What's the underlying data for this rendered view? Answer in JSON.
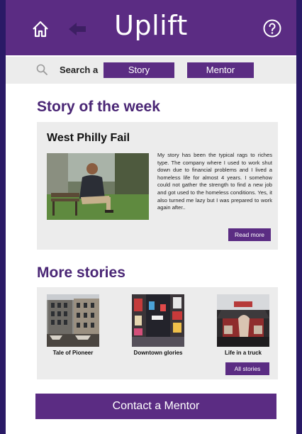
{
  "header": {
    "title": "Uplift",
    "icons": {
      "home": "home-icon",
      "back": "back-arrow-icon",
      "help": "help-icon"
    }
  },
  "search": {
    "label": "Search a",
    "options": [
      "Story",
      "Mentor"
    ]
  },
  "story_of_week": {
    "section_title": "Story of the week",
    "story_title": "West Philly Fail",
    "excerpt": "My story has been the typical rags to riches type. The company where I used to work shut down due to financial problems and I lived a homeless life for almost 4 years. I somehow could not gather the strength to find a new job and got used to the homeless conditions. Yes, it also turned me lazy but I was prepared to work again after..",
    "read_more_label": "Read more"
  },
  "more_stories": {
    "section_title": "More stories",
    "items": [
      {
        "label": "Tale of Pioneer"
      },
      {
        "label": "Downtown glories"
      },
      {
        "label": "Life in a truck"
      }
    ],
    "all_label": "All stories"
  },
  "contact": {
    "label": "Contact a Mentor"
  },
  "colors": {
    "accent": "#5b2c83",
    "section_title": "#4a2675",
    "panel": "#ececec",
    "frame": "#2a1a66"
  }
}
